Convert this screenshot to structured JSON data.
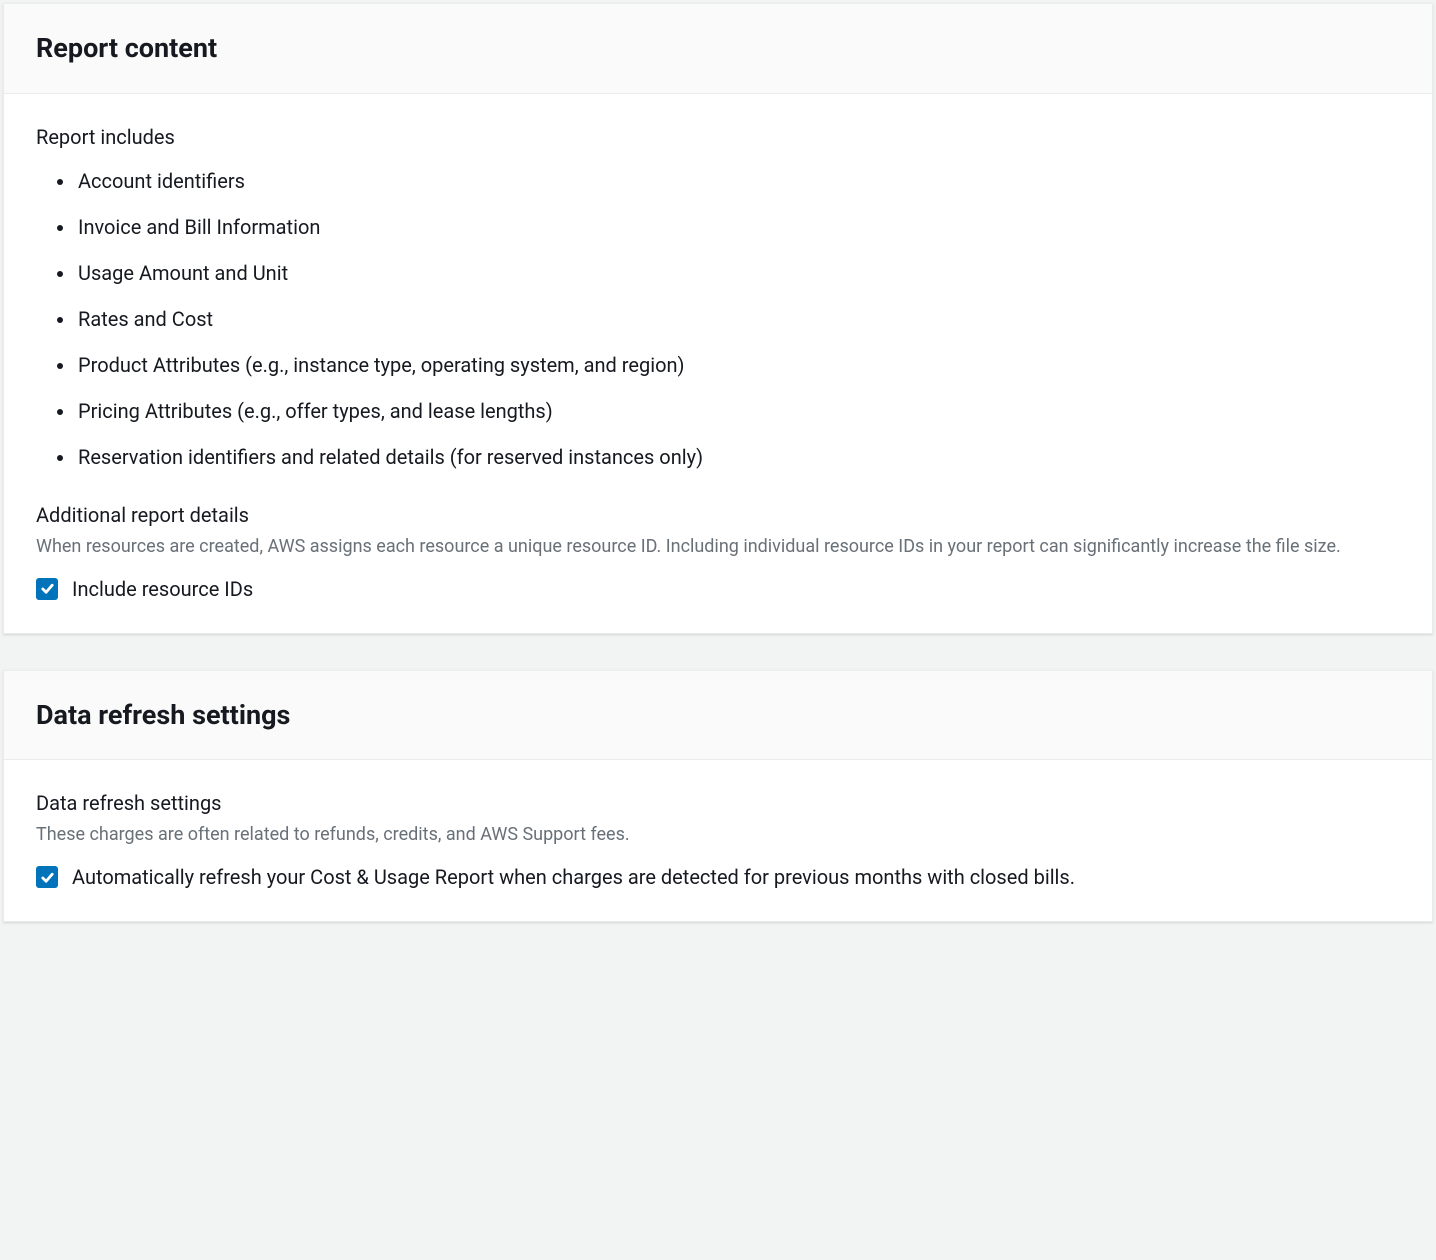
{
  "report_content": {
    "title": "Report content",
    "includes_label": "Report includes",
    "includes": [
      "Account identifiers",
      "Invoice and Bill Information",
      "Usage Amount and Unit",
      "Rates and Cost",
      "Product Attributes (e.g., instance type, operating system, and region)",
      "Pricing Attributes (e.g., offer types, and lease lengths)",
      "Reservation identifiers and related details (for reserved instances only)"
    ],
    "additional_label": "Additional report details",
    "additional_helper": "When resources are created, AWS assigns each resource a unique resource ID. Including individual resource IDs in your report can significantly increase the file size.",
    "include_resource_ids_label": "Include resource IDs",
    "include_resource_ids_checked": true
  },
  "data_refresh": {
    "title": "Data refresh settings",
    "label": "Data refresh settings",
    "helper": "These charges are often related to refunds, credits, and AWS Support fees.",
    "auto_refresh_label": "Automatically refresh your Cost & Usage Report when charges are detected for previous months with closed bills.",
    "auto_refresh_checked": true
  }
}
